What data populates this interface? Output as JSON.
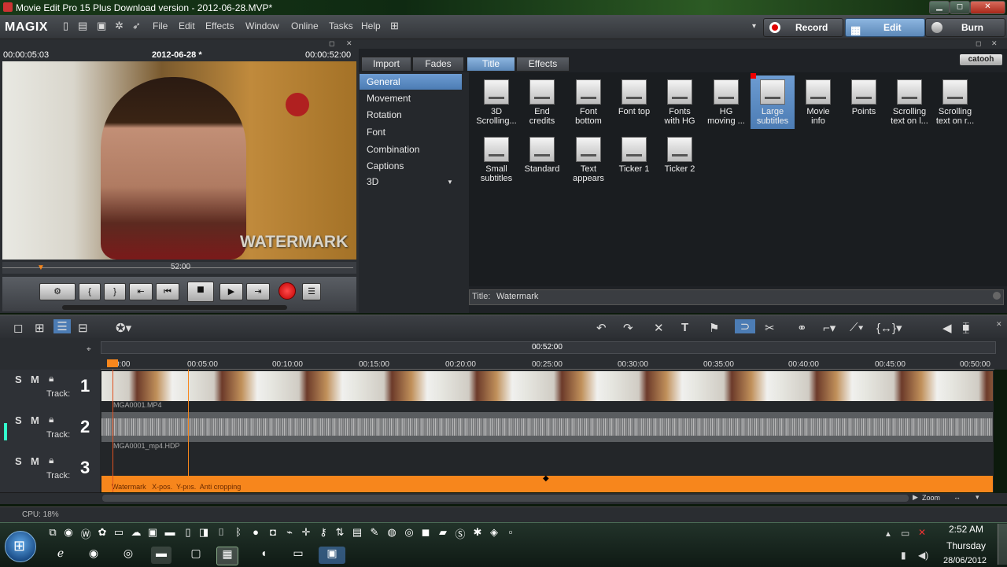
{
  "window": {
    "title": "Movie Edit Pro 15 Plus Download version - 2012-06-28.MVP*"
  },
  "menu": {
    "logo": "MAGIX",
    "items": [
      "File",
      "Edit",
      "Effects",
      "Window",
      "Online",
      "Tasks",
      "Help"
    ]
  },
  "modes": {
    "record": "Record",
    "edit": "Edit",
    "burn": "Burn"
  },
  "preview": {
    "time_left": "00:00:05:03",
    "project": "2012-06-28 *",
    "time_right": "00:00:52:00",
    "scrub_label": "52:00",
    "watermark": "WATERMARK"
  },
  "pool": {
    "tabs": [
      "Import",
      "Fades",
      "Title",
      "Effects"
    ],
    "active_tab": "Title",
    "brand": "catooh",
    "categories": [
      "General",
      "Movement",
      "Rotation",
      "Font",
      "Combination",
      "Captions",
      "3D"
    ],
    "selected_category": "General",
    "items": [
      {
        "l1": "3D",
        "l2": "Scrolling..."
      },
      {
        "l1": "End",
        "l2": "credits"
      },
      {
        "l1": "Font",
        "l2": "bottom"
      },
      {
        "l1": "Font top",
        "l2": ""
      },
      {
        "l1": "Fonts",
        "l2": "with HG"
      },
      {
        "l1": "HG",
        "l2": "moving ..."
      },
      {
        "l1": "Large",
        "l2": "subtitles"
      },
      {
        "l1": "Movie",
        "l2": "info"
      },
      {
        "l1": "Points",
        "l2": ""
      },
      {
        "l1": "Scrolling",
        "l2": "text on l..."
      },
      {
        "l1": "Scrolling",
        "l2": "text on r..."
      },
      {
        "l1": "Small",
        "l2": "subtitles"
      },
      {
        "l1": "Standard",
        "l2": ""
      },
      {
        "l1": "Text",
        "l2": "appears"
      },
      {
        "l1": "Ticker 1",
        "l2": ""
      },
      {
        "l1": "Ticker 2",
        "l2": ""
      }
    ],
    "selected_item": "Large subtitles",
    "title_label": "Title:",
    "title_value": "Watermark"
  },
  "timeline": {
    "position": "00:52:00",
    "ticks": [
      "0:00",
      "00:05:00",
      "00:10:00",
      "00:15:00",
      "00:20:00",
      "00:25:00",
      "00:30:00",
      "00:35:00",
      "00:40:00",
      "00:45:00",
      "00:50:00"
    ],
    "tracks": [
      {
        "s": "S",
        "m": "M",
        "label": "Track:",
        "num": "1",
        "clip": "MGA0001.MP4"
      },
      {
        "s": "S",
        "m": "M",
        "label": "Track:",
        "num": "2",
        "clip": "MGA0001_mp4.HDP"
      },
      {
        "s": "S",
        "m": "M",
        "label": "Track:",
        "num": "3",
        "clip": "Watermark   X-pos.  Y-pos.  Anti cropping"
      }
    ],
    "zoom": "Zoom"
  },
  "status": {
    "cpu": "CPU: 18%"
  },
  "taskbar": {
    "time": "2:52 AM",
    "day": "Thursday",
    "date": "28/06/2012"
  },
  "colors": {
    "accent": "#5c88b8",
    "orange": "#f7861c",
    "record": "#e00000"
  }
}
